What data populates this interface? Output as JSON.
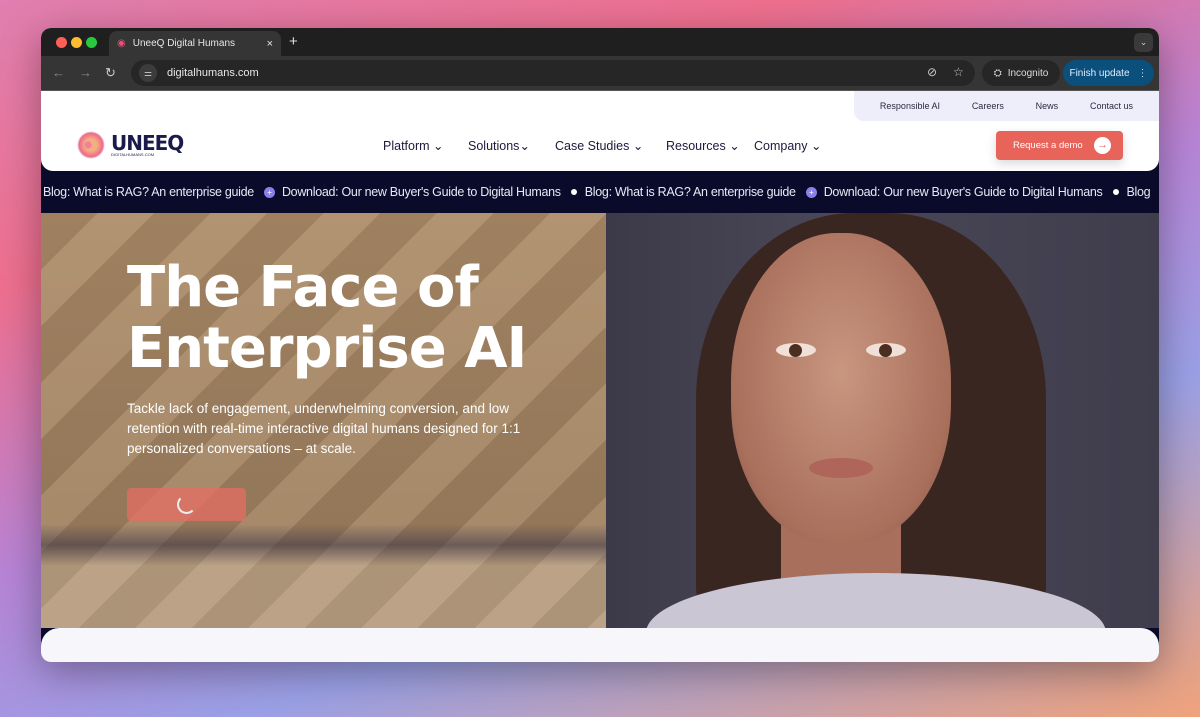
{
  "browser": {
    "tab_title": "UneeQ Digital Humans",
    "new_tab": "+",
    "tab_close": "×",
    "url": "digitalhumans.com",
    "incognito_label": "Incognito",
    "finish_update_label": "Finish update",
    "traffic_colors": [
      "#fe5f57",
      "#febc2e",
      "#28c840"
    ]
  },
  "site": {
    "logo_text": "UNEEQ",
    "logo_subtext": "DIGITALHUMANS.COM",
    "utility_links": [
      "Responsible AI",
      "Careers",
      "News",
      "Contact us"
    ],
    "menu": [
      "Platform",
      "Solutions",
      "Case Studies",
      "Resources",
      "Company"
    ],
    "cta_label": "Request a demo",
    "accent_color": "#e8635a",
    "ticker": [
      "Blog: What is RAG? An enterprise guide",
      "Download: Our new Buyer's Guide to Digital Humans",
      "Blog: What is RAG? An enterprise guide",
      "Download: Our new Buyer's Guide to Digital Humans",
      "Blog"
    ],
    "hero": {
      "title_line1": "The Face of",
      "title_line2": "Enterprise AI",
      "description": "Tackle lack of engagement, underwhelming conversion, and low retention with real-time interactive digital humans designed for 1:1 personalized conversations – at scale."
    }
  }
}
